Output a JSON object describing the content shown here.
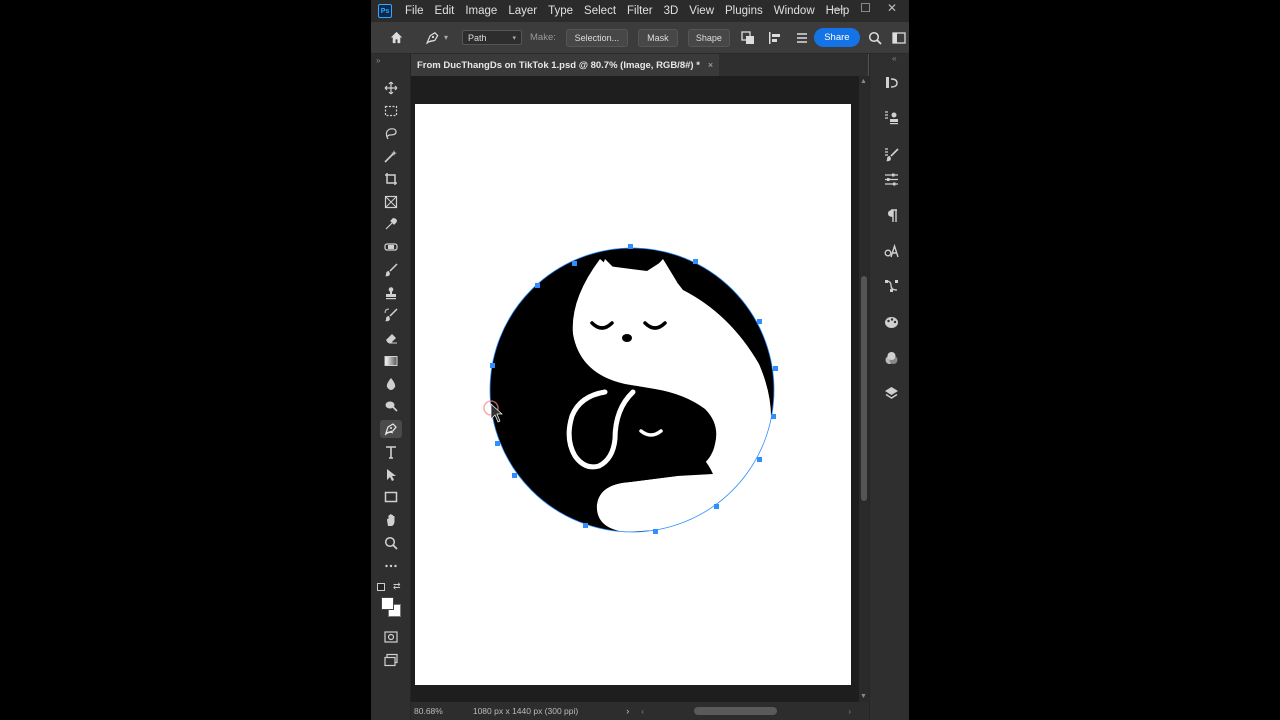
{
  "app": {
    "logo": "Ps"
  },
  "menubar": {
    "items": [
      "File",
      "Edit",
      "Image",
      "Layer",
      "Type",
      "Select",
      "Filter",
      "3D",
      "View",
      "Plugins",
      "Window",
      "Help"
    ]
  },
  "window_controls": {
    "minimize": "—",
    "maximize": "☐",
    "close": "✕"
  },
  "optionsbar": {
    "mode_value": "Path",
    "make_label": "Make:",
    "selection_label": "Selection...",
    "mask_label": "Mask",
    "shape_label": "Shape",
    "share_label": "Share"
  },
  "document": {
    "tab_title": "From DucThangDs on TikTok 1.psd @ 80.7% (Image, RGB/8#) *",
    "tab_close": "×"
  },
  "status": {
    "zoom": "80.68%",
    "doc_size": "1080 px x 1440 px (300 ppi)",
    "arrow": "›"
  },
  "icons": {
    "toolbar": [
      "move-icon",
      "marquee-icon",
      "lasso-icon",
      "magic-wand-icon",
      "crop-icon",
      "frame-icon",
      "eyedropper-icon",
      "healing-brush-icon",
      "brush-icon",
      "clone-stamp-icon",
      "history-brush-icon",
      "eraser-icon",
      "gradient-icon",
      "blur-icon",
      "dodge-icon",
      "pen-icon",
      "type-icon",
      "path-selection-icon",
      "rectangle-icon",
      "hand-icon",
      "zoom-icon",
      "more-tools-icon",
      "quick-mask-icon",
      "screen-mode-icon"
    ],
    "panels": [
      "history-panel-icon",
      "clone-source-icon",
      "brush-settings-icon",
      "adjustments-icon",
      "paragraph-icon",
      "character-styles-icon",
      "paths-icon",
      "swatches-icon",
      "channels-icon",
      "layers-icon"
    ]
  },
  "colors": {
    "accent": "#1473e6",
    "path_anchor": "#2f8fff",
    "foreground": "#ffffff",
    "background": "#ffffff"
  }
}
